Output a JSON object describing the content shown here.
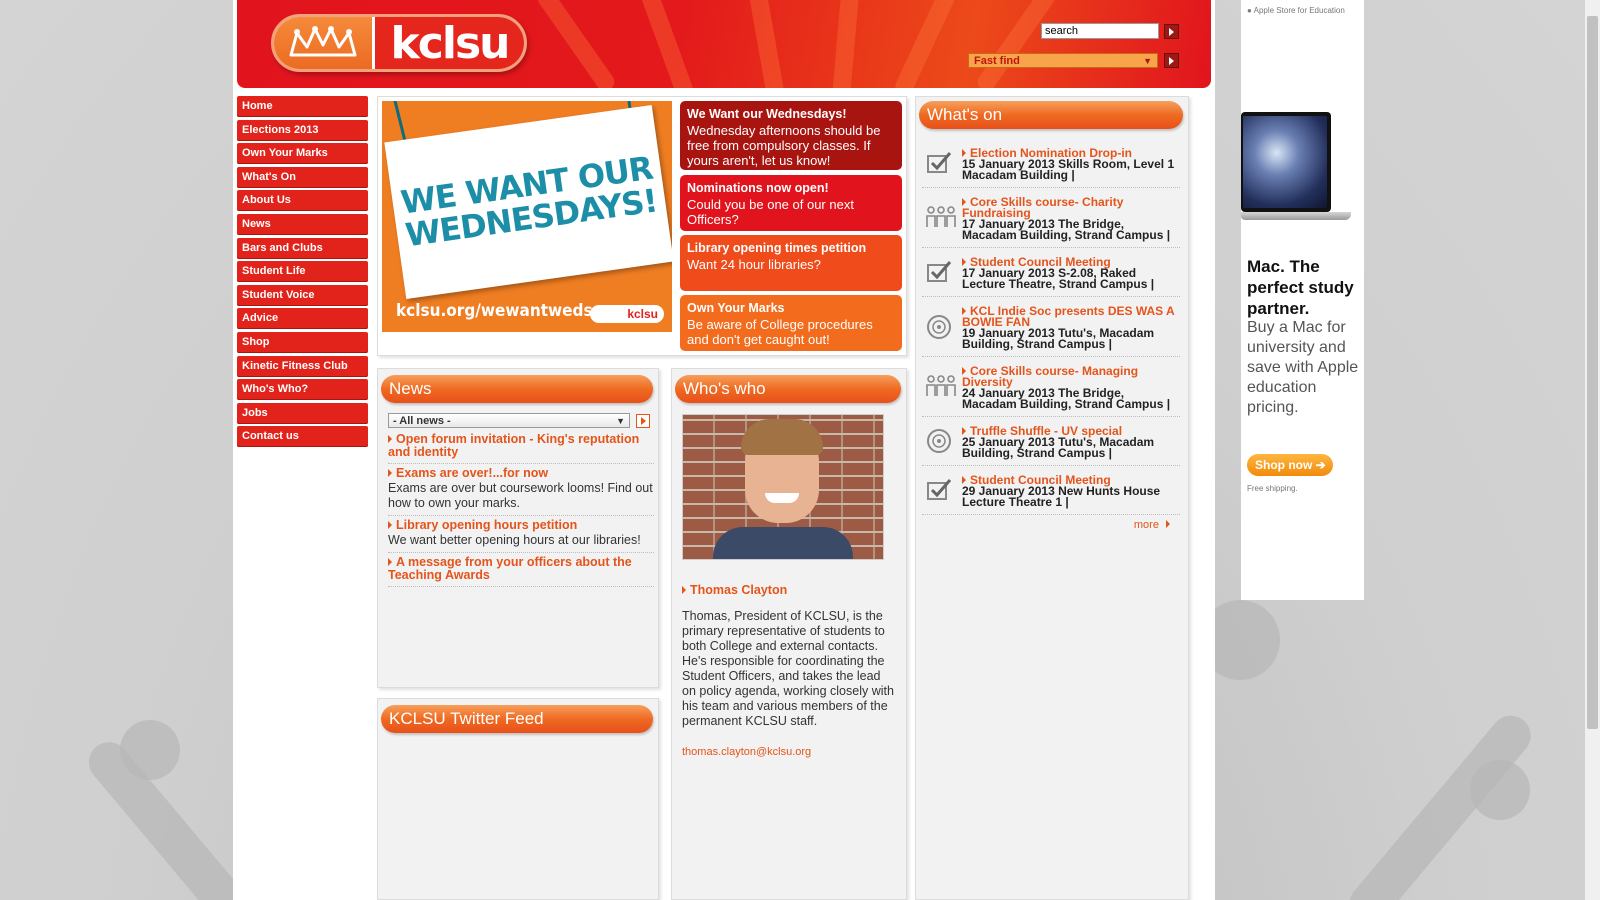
{
  "header": {
    "logo_text": "kclsu",
    "search_value": "search",
    "fastfind_label": "Fast find"
  },
  "nav": [
    {
      "label": "Home"
    },
    {
      "label": "Elections 2013"
    },
    {
      "label": "Own Your Marks"
    },
    {
      "label": "What's On"
    },
    {
      "label": "About Us"
    },
    {
      "label": "News"
    },
    {
      "label": "Bars and Clubs"
    },
    {
      "label": "Student Life"
    },
    {
      "label": "Student Voice"
    },
    {
      "label": "Advice"
    },
    {
      "label": "Shop"
    },
    {
      "label": "Kinetic Fitness Club"
    },
    {
      "label": "Who's Who?"
    },
    {
      "label": "Jobs"
    },
    {
      "label": "Contact us"
    }
  ],
  "feature": {
    "image_text": "WE WANT OUR WEDNESDAYS!",
    "image_url_text": "kclsu.org/wewantweds",
    "image_logo": "kclsu",
    "promos": [
      {
        "title": "We Want our Wednesdays!",
        "text": "Wednesday afternoons should be free from compulsory classes. If yours aren't, let us know!",
        "color": "#a8140f"
      },
      {
        "title": "Nominations now open!",
        "text": "Could you be one of our next Officers?",
        "color": "#e1141d"
      },
      {
        "title": "Library opening times petition",
        "text": "Want 24 hour libraries?",
        "color": "#ef4b1b"
      },
      {
        "title": "Own Your Marks",
        "text": "Be aware of College procedures and don't get caught out!",
        "color": "#f36b1c"
      }
    ]
  },
  "news": {
    "heading": "News",
    "filter_value": "- All news -",
    "items": [
      {
        "title": "Open forum invitation - King's reputation and identity",
        "desc": ""
      },
      {
        "title": "Exams are over!...for now",
        "desc": "Exams are over but coursework looms! Find out how to own your marks."
      },
      {
        "title": "Library opening hours petition",
        "desc": "We want better opening hours at our libraries!"
      },
      {
        "title": "A message from your officers about the Teaching Awards",
        "desc": ""
      }
    ]
  },
  "twitter": {
    "heading": "KCLSU Twitter Feed"
  },
  "whoswho": {
    "heading": "Who's who",
    "name": "Thomas Clayton",
    "bio": "Thomas, President of KCLSU, is the primary representative of students to both College and external contacts. He's responsible for coordinating the Student Officers, and takes the lead on policy agenda, working closely with his team and various members of the permanent KCLSU staff.",
    "email": "thomas.clayton@kclsu.org"
  },
  "whatson": {
    "heading": "What's on",
    "more_label": "more",
    "events": [
      {
        "title": "Election Nomination Drop-in",
        "details": "15 January 2013 Skills Room, Level 1 Macadam Building |",
        "icon": "checkbox-icon"
      },
      {
        "title": "Core Skills course- Charity Fundraising",
        "details": "17 January 2013 The Bridge, Macadam Building, Strand Campus |",
        "icon": "people-icon"
      },
      {
        "title": "Student Council Meeting",
        "details": "17 January 2013 S-2.08, Raked Lecture Theatre, Strand Campus |",
        "icon": "checkbox-icon"
      },
      {
        "title": "KCL Indie Soc presents DES WAS A BOWIE FAN",
        "details": "19 January 2013 Tutu's, Macadam Building, Strand Campus |",
        "icon": "disc-icon"
      },
      {
        "title": "Core Skills course- Managing Diversity",
        "details": "24 January 2013 The Bridge, Macadam Building, Strand Campus |",
        "icon": "people-icon"
      },
      {
        "title": "Truffle Shuffle - UV special",
        "details": "25 January 2013 Tutu's, Macadam Building, Strand Campus |",
        "icon": "disc-icon"
      },
      {
        "title": "Student Council Meeting",
        "details": "29 January 2013 New Hunts House Lecture Theatre 1 |",
        "icon": "checkbox-icon"
      }
    ]
  },
  "ad": {
    "store_label": "Apple Store for Education",
    "headline": "Mac. The perfect study partner.",
    "body": "Buy a Mac for university and save with Apple education pricing.",
    "button": "Shop now",
    "footnote": "Free shipping."
  }
}
